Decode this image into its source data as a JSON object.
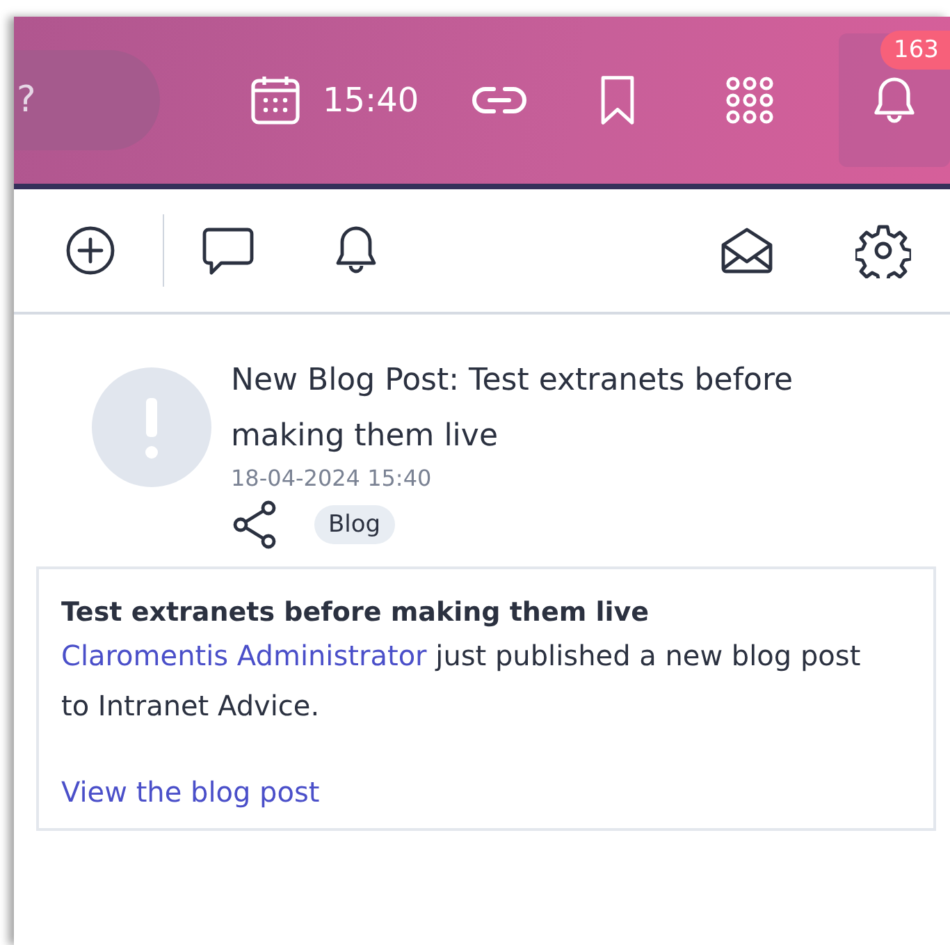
{
  "header": {
    "search_hint": "?",
    "time": "15:40",
    "notification_count": "163"
  },
  "notification": {
    "title": "New Blog Post: Test extranets before making them live",
    "date": "18-04-2024 15:40",
    "tag": "Blog",
    "card": {
      "heading": "Test extranets before making them live",
      "author": "Claromentis Administrator",
      "text": " just published a new blog post to Intranet Advice.",
      "link": "View the blog post"
    }
  }
}
